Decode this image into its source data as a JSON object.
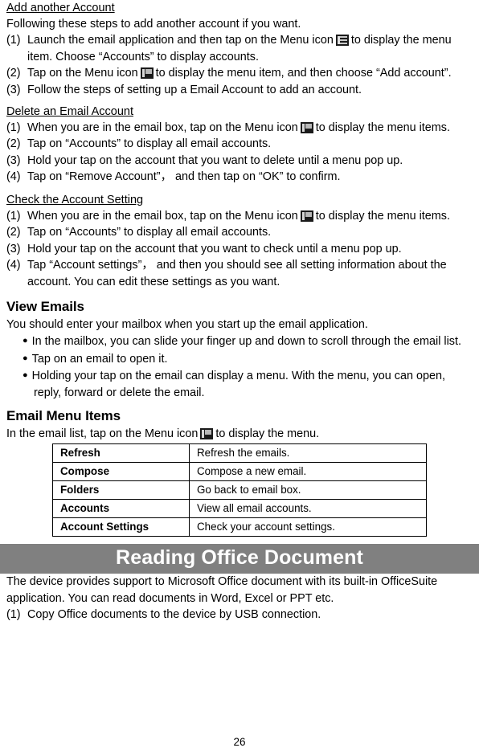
{
  "document": {
    "page_number": "26"
  },
  "sections": {
    "add_account": {
      "heading": "Add another Account",
      "intro": "Following these steps to add another account if you want.",
      "steps": [
        {
          "marker": "(1)",
          "text_before_icon": "Launch the email application and then tap on the Menu icon",
          "icon": "menu-icon",
          "text_after_icon": "to display the menu item. Choose “Accounts” to display accounts."
        },
        {
          "marker": "(2)",
          "text_before_icon": "Tap on the Menu icon",
          "icon": "menu-icon",
          "text_after_icon": "to display the menu item, and then choose “Add account”."
        },
        {
          "marker": "(3)",
          "text_before_icon": "Follow the steps of setting up a Email Account to add an account.",
          "icon": "",
          "text_after_icon": ""
        }
      ]
    },
    "delete_account": {
      "heading": "Delete an Email Account",
      "steps": [
        {
          "marker": "(1)",
          "text_before_icon": "When you are in the email box, tap on the Menu icon",
          "icon": "menu-icon",
          "text_after_icon": "to display the menu items."
        },
        {
          "marker": "(2)",
          "text_before_icon": "Tap on “Accounts” to display all email accounts.",
          "icon": "",
          "text_after_icon": ""
        },
        {
          "marker": "(3)",
          "text_before_icon": "Hold your tap on the account that you want to delete until a menu pop up.",
          "icon": "",
          "text_after_icon": ""
        },
        {
          "marker": "(4)",
          "text_before_icon": "Tap on “Remove Account”， and then tap on “OK” to confirm.",
          "icon": "",
          "text_after_icon": ""
        }
      ]
    },
    "check_account": {
      "heading": "Check the Account Setting",
      "steps": [
        {
          "marker": "(1)",
          "text_before_icon": "When you are in the email box, tap on the Menu icon",
          "icon": "menu-icon",
          "text_after_icon": "to display the menu items."
        },
        {
          "marker": "(2)",
          "text_before_icon": "Tap on “Accounts” to display all email accounts.",
          "icon": "",
          "text_after_icon": ""
        },
        {
          "marker": "(3)",
          "text_before_icon": "Hold your tap on the account that you want to check until a menu pop up.",
          "icon": "",
          "text_after_icon": ""
        },
        {
          "marker": "(4)",
          "text_before_icon": "Tap “Account settings”， and then you should see all setting information about the account. You can edit these settings as you want.",
          "icon": "",
          "text_after_icon": ""
        }
      ]
    },
    "view_emails": {
      "heading": "View Emails",
      "intro": "You should enter your mailbox when you start up the email application.",
      "bullets": [
        "In the mailbox, you can slide your finger up and down to scroll through the email list.",
        "Tap on an email to open it.",
        "Holding your tap on the email can display a menu. With the menu, you can open, reply, forward or delete the email."
      ]
    },
    "email_menu_items": {
      "heading": "Email Menu Items",
      "intro_before_icon": "In the email list, tap on the Menu icon",
      "intro_icon": "menu-icon",
      "intro_after_icon": "to display the menu.",
      "table": {
        "rows": [
          {
            "name": "Refresh",
            "description": "Refresh the emails."
          },
          {
            "name": "Compose",
            "description": "Compose a new email."
          },
          {
            "name": "Folders",
            "description": "Go back to email box."
          },
          {
            "name": "Accounts",
            "description": "View all email accounts."
          },
          {
            "name": "Account Settings",
            "description": "Check your account settings."
          }
        ]
      }
    },
    "reading_office_document": {
      "banner_title": "Reading Office Document",
      "banner_color": "#808080",
      "paragraph": "The device provides support to Microsoft Office document with its built-in OfficeSuite application. You can read documents in Word, Excel or PPT etc.",
      "steps": [
        {
          "marker": "(1)",
          "text": "Copy Office documents to the device by USB connection."
        }
      ]
    }
  }
}
